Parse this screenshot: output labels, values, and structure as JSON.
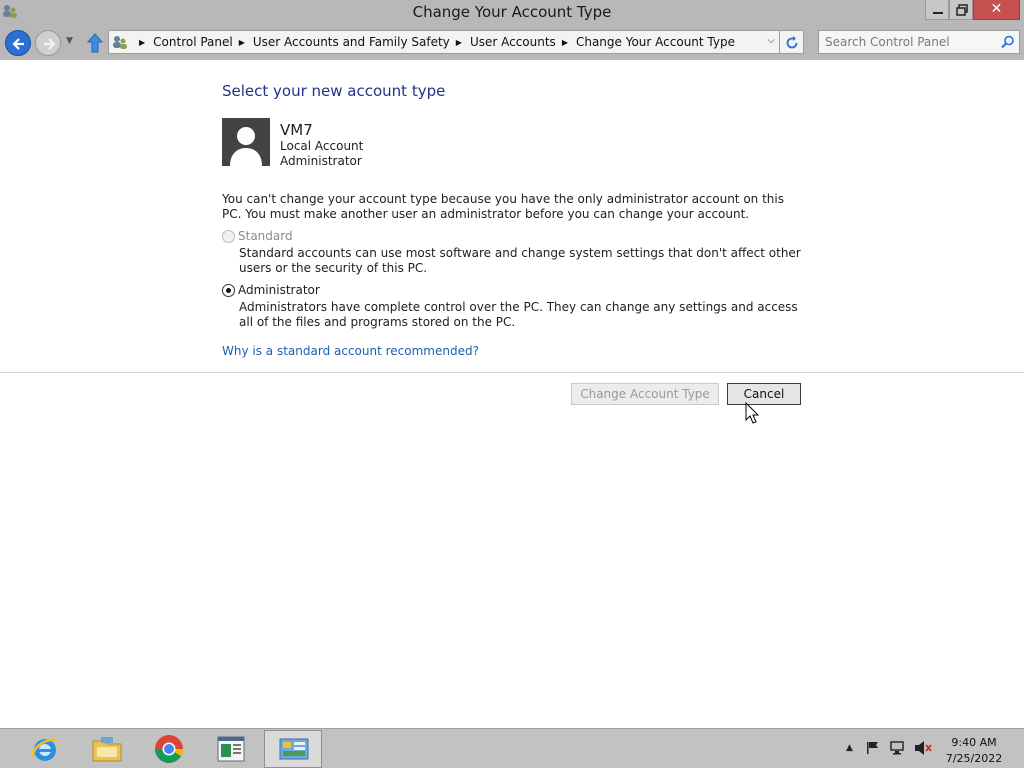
{
  "window": {
    "title": "Change Your Account Type",
    "close_label": "✕"
  },
  "navigation": {
    "breadcrumbs": [
      "Control Panel",
      "User Accounts and Family Safety",
      "User Accounts",
      "Change Your Account Type"
    ],
    "search_placeholder": "Search Control Panel"
  },
  "main": {
    "heading": "Select your new account type",
    "user": {
      "name": "VM7",
      "account_type": "Local Account",
      "role": "Administrator"
    },
    "notice": "You can't change your account type because you have the only administrator account on this PC. You must make another user an administrator before you can change your account.",
    "options": [
      {
        "label": "Standard",
        "description": "Standard accounts can use most software and change system settings that don't affect other users or the security of this PC.",
        "selected": false,
        "disabled": true
      },
      {
        "label": "Administrator",
        "description": "Administrators have complete control over the PC. They can change any settings and access all of the files and programs stored on the PC.",
        "selected": true,
        "disabled": false
      }
    ],
    "help_link": "Why is a standard account recommended?",
    "buttons": {
      "change_label": "Change Account Type",
      "cancel_label": "Cancel"
    }
  },
  "taskbar": {
    "apps": [
      "internet-explorer",
      "file-explorer",
      "chrome",
      "document-viewer",
      "control-panel"
    ],
    "tray": [
      "show-hidden-icons",
      "action-center-flag",
      "network",
      "volume-muted"
    ],
    "clock": {
      "time": "9:40 AM",
      "date": "7/25/2022"
    }
  },
  "colors": {
    "heading_blue": "#1e3287",
    "link_blue": "#1e5fb0",
    "chrome_gray": "#b8b8b8",
    "close_red": "#c75050"
  }
}
